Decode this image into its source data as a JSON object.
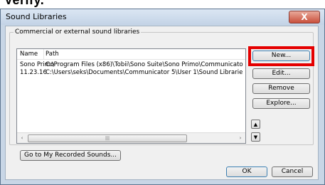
{
  "page_cut_text": "Verify.",
  "window": {
    "title": "Sound Libraries",
    "close_glyph": "X"
  },
  "group": {
    "label": "Commercial or external sound libraries"
  },
  "list": {
    "columns": [
      "Name",
      "Path"
    ],
    "rows": [
      {
        "name": "Sono Primo",
        "path": "C:\\Program Files (x86)\\Tobii\\Sono Suite\\Sono Primo\\Communicato"
      },
      {
        "name": "11.23.16",
        "path": "C:\\Users\\seks\\Documents\\Communicator 5\\User 1\\Sound Librarie"
      }
    ],
    "scroll_left": "‹",
    "scroll_right": "›",
    "thumb_grip": "|||"
  },
  "buttons": {
    "new": "New...",
    "edit": "Edit...",
    "remove": "Remove",
    "explore": "Explore...",
    "move_up": "▲",
    "move_down": "▼",
    "recorded": "Go to My Recorded Sounds...",
    "ok": "OK",
    "cancel": "Cancel"
  },
  "colors": {
    "highlight": "#e50000",
    "close": "#c9503c"
  }
}
